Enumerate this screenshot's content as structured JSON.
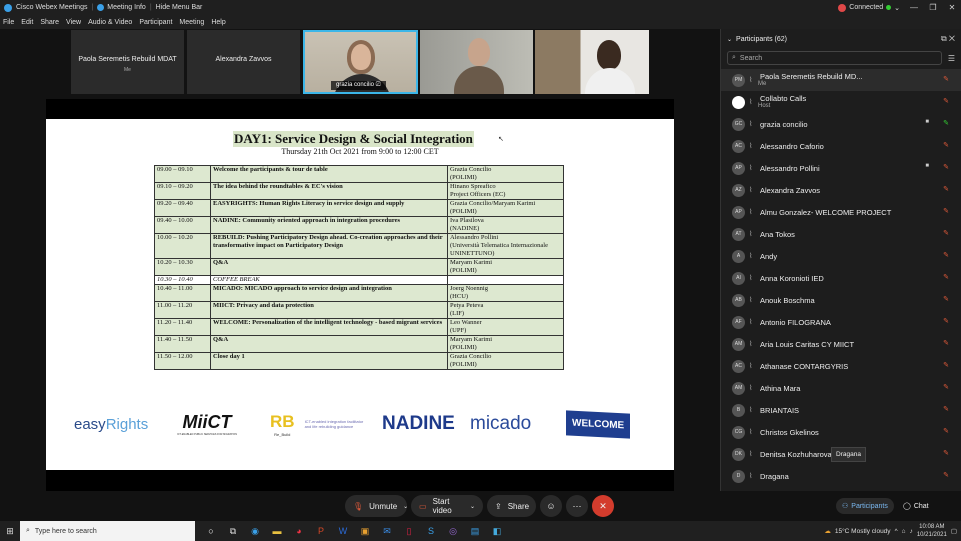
{
  "titlebar": {
    "app_name": "Cisco Webex Meetings",
    "meeting_info": "Meeting Info",
    "hide_menu_bar": "Hide Menu Bar",
    "status": "Connected",
    "chevron": "⌄",
    "minimize": "—",
    "restore": "❐",
    "close": "✕"
  },
  "menu": [
    "File",
    "Edit",
    "Share",
    "View",
    "Audio & Video",
    "Participant",
    "Meeting",
    "Help"
  ],
  "thumbnails": [
    {
      "name": "Paola Seremetis Rebuild MDAT",
      "sub": "Me"
    },
    {
      "name": "Alexandra Zavvos"
    },
    {
      "name": "grazia concilio"
    },
    {
      "name": ""
    },
    {
      "name": ""
    }
  ],
  "slide": {
    "title": "DAY1: Service Design & Social Integration",
    "subtitle": "Thursday 21th Oct 2021 from 9:00 to 12:00 CET",
    "cursor": "↖",
    "rows": [
      {
        "time": "09.00 – 09.10",
        "topic": "Welcome the participants & tour de table",
        "speaker": "Grazia Concilio\n(POLIMI)"
      },
      {
        "time": "09.10 – 09.20",
        "topic": "The idea behind the roundtables & EC's vision",
        "speaker": "Hinano Spreafico\nProject Officers (EC)"
      },
      {
        "time": "09.20 – 09.40",
        "topic": "EASYRIGHTS: Human Rights Literacy in service design and supply",
        "speaker": "Grazia Concilio/Maryam Karimi (POLIMI)"
      },
      {
        "time": "09.40 – 10.00",
        "topic": "NADINE: Community oriented approach in integration procedures",
        "speaker": "Iva Plasilova\n(NADINE)"
      },
      {
        "time": "10.00 – 10.20",
        "topic": "REBUILD: Pushing Participatory Design ahead. Co-creation approaches and their transformative impact on Participatory Design",
        "speaker": "Alessandro Pollini\n(Università Telematica Internazionale UNINETTUNO)"
      },
      {
        "time": "10.20 – 10.30",
        "topic": "Q&A",
        "speaker": "Maryam Karimi\n(POLIMI)"
      },
      {
        "time": "10.30 – 10.40",
        "topic": "COFFEE BREAK",
        "speaker": "",
        "break": true
      },
      {
        "time": "10.40 – 11.00",
        "topic": "MICADO: MICADO approach to service design and integration",
        "speaker": "Joerg Noennig\n(HCU)"
      },
      {
        "time": "11.00 – 11.20",
        "topic": "MIICT: Privacy and data protection",
        "speaker": "Petya Peteva\n(LIF)"
      },
      {
        "time": "11.20 – 11.40",
        "topic": "WELCOME: Personalization of the intelligent technology - based migrant services",
        "speaker": "Leo Wanner\n(UPF)"
      },
      {
        "time": "11.40 – 11.50",
        "topic": "Q&A",
        "speaker": "Maryam Karimi\n(POLIMI)"
      },
      {
        "time": "11.50 – 12.00",
        "topic": "Close day 1",
        "speaker": "Grazia Concilio\n(POLIMI)"
      }
    ],
    "logos": {
      "easyrights_a": "easy",
      "easyrights_b": "Rights",
      "miict": "MiiCT",
      "miict_tag": "ICT-ENABLED PUBLIC SERVICES FOR MIGRATION",
      "rebuild": "RB",
      "rebuild_sub": "Re_Build",
      "rebuild_desc": "ICT-enabled integration facilitator and life rebuilding guidance",
      "nadine": "NADINE",
      "micado": "micado",
      "welcome": "WELCOME"
    }
  },
  "panel": {
    "title": "Participants (62)",
    "chevron": "⌄",
    "popout": "⧉",
    "close": "✕",
    "search_placeholder": "Search",
    "filter_icon": "☰",
    "participants": [
      {
        "initials": "PM",
        "name": "Paola Seremetis Rebuild MD...",
        "sub": "Me"
      },
      {
        "initials": "",
        "name": "Collabto Calls",
        "sub": "Host"
      },
      {
        "initials": "GC",
        "name": "grazia concilio"
      },
      {
        "initials": "AC",
        "name": "Alessandro Caforio"
      },
      {
        "initials": "AP",
        "name": "Alessandro Pollini"
      },
      {
        "initials": "AZ",
        "name": "Alexandra Zavvos"
      },
      {
        "initials": "AP",
        "name": "Almu Gonzalez- WELCOME PROJECT"
      },
      {
        "initials": "AT",
        "name": "Ana Tokos"
      },
      {
        "initials": "A",
        "name": "Andy"
      },
      {
        "initials": "AI",
        "name": "Anna Koronioti IED"
      },
      {
        "initials": "AB",
        "name": "Anouk Boschma"
      },
      {
        "initials": "AF",
        "name": "Antonio FILOGRANA"
      },
      {
        "initials": "AM",
        "name": "Aria Louis Caritas CY MIICT"
      },
      {
        "initials": "AC",
        "name": "Athanase CONTARGYRIS"
      },
      {
        "initials": "AM",
        "name": "Athina Mara"
      },
      {
        "initials": "B",
        "name": "BRIANTAIS"
      },
      {
        "initials": "CG",
        "name": "Christos Gkelinos"
      },
      {
        "initials": "DK",
        "name": "Denitsa Kozhuharova"
      },
      {
        "initials": "D",
        "name": "Dragana"
      }
    ],
    "tooltip": "Dragana"
  },
  "controls": {
    "unmute": "Unmute",
    "start_video": "Start video",
    "share": "Share",
    "participants": "Participants",
    "chat": "Chat"
  },
  "taskbar": {
    "search_placeholder": "Type here to search",
    "weather": "15°C  Mostly cloudy",
    "time": "10:08 AM",
    "date": "10/21/2021"
  }
}
